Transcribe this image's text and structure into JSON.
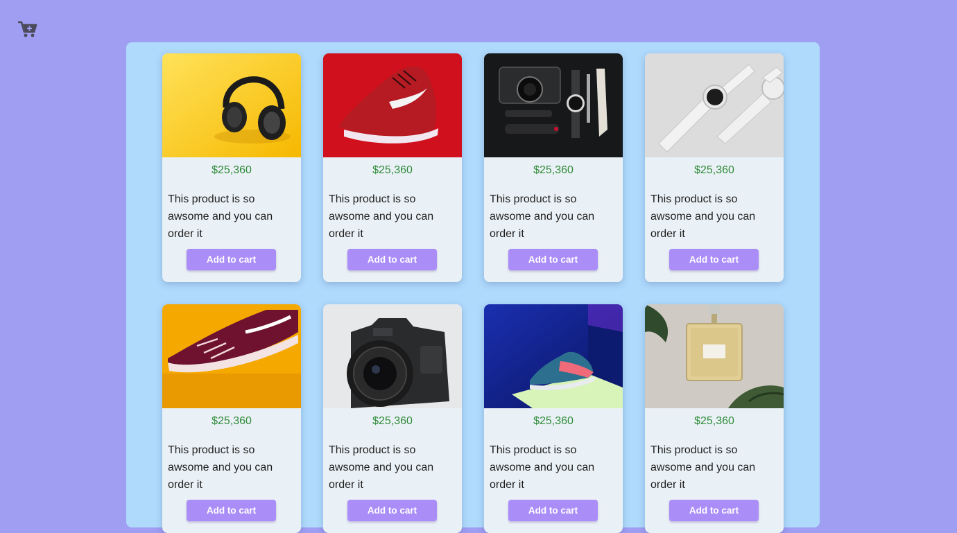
{
  "header": {
    "cart_icon": "shopping-cart-add-icon"
  },
  "colors": {
    "background": "#a09ef2",
    "panel": "#afdafc",
    "card": "#eaf1f6",
    "price": "#2f8a3a",
    "button": "#ab8df8"
  },
  "products": [
    {
      "image": "headphones-on-yellow",
      "price": "$25,360",
      "description": "This product is so awsome and you can order it",
      "button_label": "Add to cart"
    },
    {
      "image": "red-sneaker",
      "price": "$25,360",
      "description": "This product is so awsome and you can order it",
      "button_label": "Add to cart"
    },
    {
      "image": "camera-and-tools-flatlay",
      "price": "$25,360",
      "description": "This product is so awsome and you can order it",
      "button_label": "Add to cart"
    },
    {
      "image": "white-smartwatch",
      "price": "$25,360",
      "description": "This product is so awsome and you can order it",
      "button_label": "Add to cart"
    },
    {
      "image": "maroon-skate-shoe",
      "price": "$25,360",
      "description": "This product is so awsome and you can order it",
      "button_label": "Add to cart"
    },
    {
      "image": "nikon-dslr-camera",
      "price": "$25,360",
      "description": "This product is so awsome and you can order it",
      "button_label": "Add to cart"
    },
    {
      "image": "sneaker-on-pedestal",
      "price": "$25,360",
      "description": "This product is so awsome and you can order it",
      "button_label": "Add to cart"
    },
    {
      "image": "perfume-bottle",
      "price": "$25,360",
      "description": "This product is so awsome and you can order it",
      "button_label": "Add to cart"
    }
  ]
}
